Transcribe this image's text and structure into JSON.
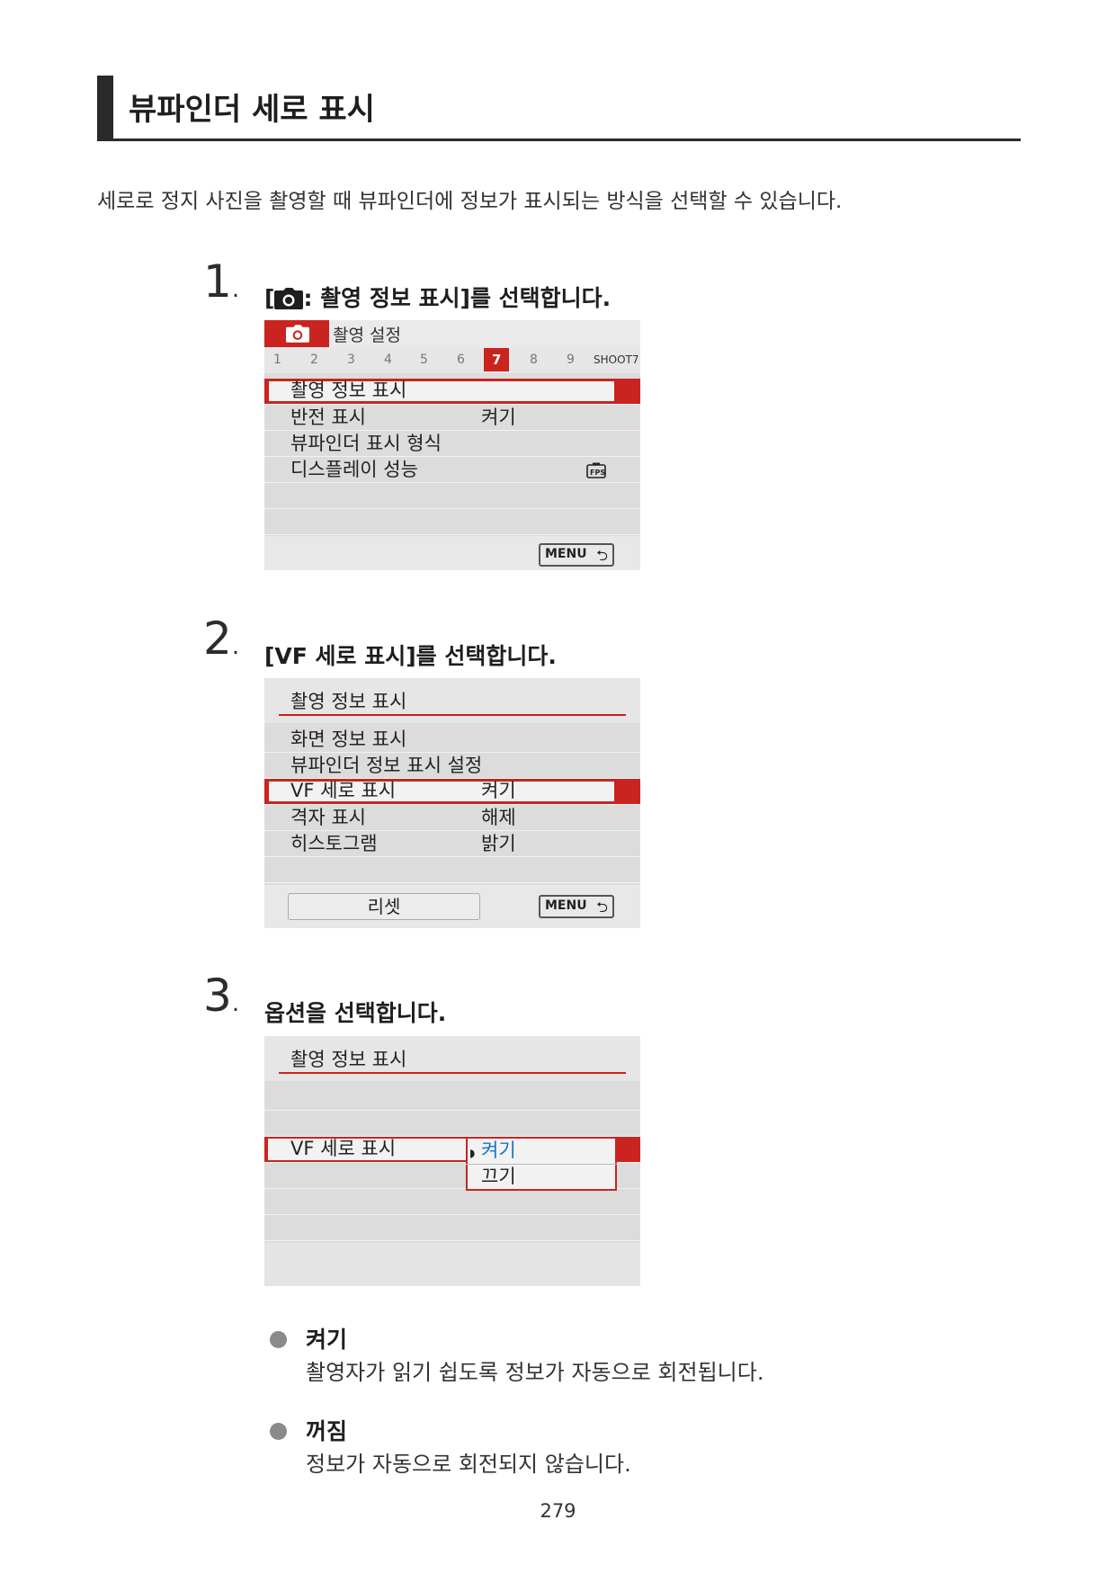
{
  "heading": "뷰파인더 세로 표시",
  "intro": "세로로 정지 사진을 촬영할 때 뷰파인더에 정보가 표시되는 방식을 선택할 수 있습니다.",
  "steps": [
    {
      "number": "1",
      "title": "[ : 촬영 정보 표시]를 선택합니다."
    },
    {
      "number": "2",
      "title": "[VF 세로 표시]를 선택합니다."
    },
    {
      "number": "3",
      "title": "옵션을 선택합니다."
    }
  ],
  "step1_title_after_icon": ": 촬영 정보 표시]를 선택합니다.",
  "screen1": {
    "tab_title": "촬영 설정",
    "tabs": [
      "1",
      "2",
      "3",
      "4",
      "5",
      "6",
      "7",
      "8",
      "9"
    ],
    "active_tab": "7",
    "tab_code": "SHOOT7",
    "items": [
      {
        "label": "촬영 정보 표시",
        "value": ""
      },
      {
        "label": "반전 표시",
        "value": "켜기"
      },
      {
        "label": "뷰파인더 표시 형식",
        "value": ""
      },
      {
        "label": "디스플레이 성능",
        "value": ""
      }
    ],
    "menu_button": "MENU"
  },
  "screen2": {
    "title": "촬영 정보 표시",
    "items": [
      {
        "label": "화면 정보 표시",
        "value": ""
      },
      {
        "label": "뷰파인더 정보 표시 설정",
        "value": ""
      },
      {
        "label": "VF 세로 표시",
        "value": "켜기"
      },
      {
        "label": "격자 표시",
        "value": "해제"
      },
      {
        "label": "히스토그램",
        "value": "밝기"
      }
    ],
    "reset_button": "리셋",
    "menu_button": "MENU"
  },
  "screen3": {
    "title": "촬영 정보 표시",
    "item_label": "VF 세로 표시",
    "options": [
      "켜기",
      "끄기"
    ],
    "selected_option": "켜기"
  },
  "options_desc": [
    {
      "title": "켜기",
      "text": "촬영자가 읽기 쉽도록 정보가 자동으로 회전됩니다."
    },
    {
      "title": "꺼짐",
      "text": "정보가 자동으로 회전되지 않습니다."
    }
  ],
  "page_number": "279",
  "colors": {
    "accent_red": "#c9241f",
    "screen_gray": "#dcdcdc",
    "option_blue": "#1a73c8"
  }
}
